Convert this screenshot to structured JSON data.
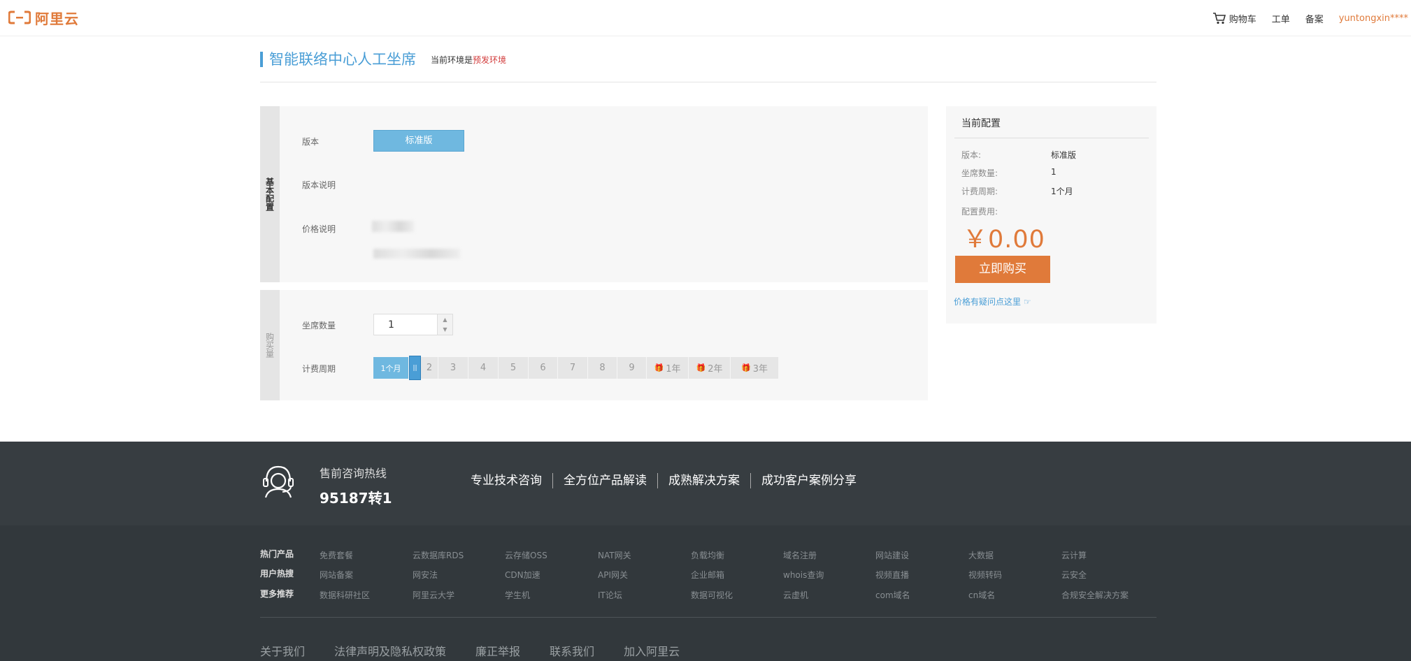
{
  "header": {
    "logo_text": "阿里云",
    "nav": [
      "购物车",
      "工单",
      "备案"
    ],
    "username": "yuntongxin****",
    "brand_color": "#e07a3a"
  },
  "page": {
    "title": "智能联络中心人工坐席",
    "env_prefix": "当前环境是",
    "env_value": "预发环境"
  },
  "basic_config": {
    "side_label": "基本配置",
    "edition_label": "版本",
    "edition_value": "标准版",
    "edition_desc_label": "版本说明",
    "price_desc_label": "价格说明"
  },
  "purchase": {
    "side_label": "购买量",
    "seat_label": "坐席数量",
    "seat_value": "1",
    "period_label": "计费周期",
    "period_selected": "1个月",
    "period_options": [
      "2",
      "3",
      "4",
      "5",
      "6",
      "7",
      "8",
      "9"
    ],
    "year_options": [
      "1年",
      "2年",
      "3年"
    ]
  },
  "summary": {
    "title": "当前配置",
    "edition_key": "版本:",
    "edition_val": "标准版",
    "seats_key": "坐席数量:",
    "seats_val": "1",
    "period_key": "计费周期:",
    "period_val": "1个月",
    "fee_key": "配置费用:",
    "price": "￥0.00",
    "buy_button": "立即购买",
    "price_question": "价格有疑问点这里 ☞"
  },
  "footer": {
    "hotline_label": "售前咨询热线",
    "hotline_number": "95187转1",
    "services": [
      "专业技术咨询",
      "全方位产品解读",
      "成熟解决方案",
      "成功客户案例分享"
    ],
    "categories": [
      "热门产品",
      "用户热搜",
      "更多推荐"
    ],
    "rows": [
      [
        "免费套餐",
        "云数据库RDS",
        "云存储OSS",
        "NAT网关",
        "负载均衡",
        "域名注册",
        "网站建设",
        "大数据",
        "云计算"
      ],
      [
        "网站备案",
        "网安法",
        "CDN加速",
        "API网关",
        "企业邮箱",
        "whois查询",
        "视频直播",
        "视频转码",
        "云安全"
      ],
      [
        "数据科研社区",
        "阿里云大学",
        "学生机",
        "IT论坛",
        "数据可视化",
        "云虚机",
        "com域名",
        "cn域名",
        "合规安全解决方案"
      ]
    ],
    "bottom_links": [
      "关于我们",
      "法律声明及隐私权政策",
      "廉正举报",
      "联系我们",
      "加入阿里云"
    ]
  }
}
